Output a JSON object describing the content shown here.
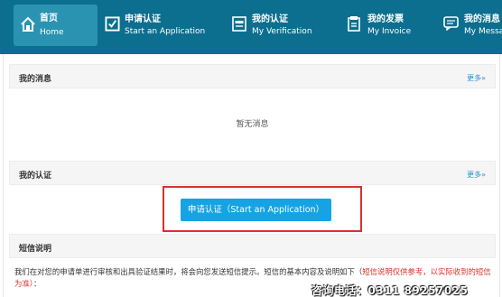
{
  "nav": {
    "items": [
      {
        "zh": "首页",
        "en": "Home",
        "icon": "home-icon"
      },
      {
        "zh": "申请认证",
        "en": "Start an Application",
        "icon": "checkbox-icon"
      },
      {
        "zh": "我的认证",
        "en": "My Verification",
        "icon": "certificate-icon"
      },
      {
        "zh": "我的发票",
        "en": "My Invoice",
        "icon": "invoice-icon"
      },
      {
        "zh": "我的消息",
        "en": "My Messa",
        "icon": "message-icon"
      }
    ],
    "colors": {
      "bar": "#0c6f8f",
      "active": "#2a93b1"
    }
  },
  "messages": {
    "title": "我的消息",
    "more": "更多»",
    "empty": "暂无消息"
  },
  "verification": {
    "title": "我的认证",
    "more": "更多»",
    "apply_button": "申请认证（Start an Application）"
  },
  "sms": {
    "title": "短信说明",
    "text": "我们在对您的申请单进行审核和出具验证结果时，将会向您发送短信提示。短信的基本内容及说明如下（",
    "text_red": "短信说明仅供参考，以实际收到的短信为准）",
    "text_tail": "："
  },
  "watermark": "咨询电话：0311 89257025",
  "accent": {
    "button": "#16a3e3",
    "highlight": "#d93030",
    "link": "#2a8fd0"
  }
}
